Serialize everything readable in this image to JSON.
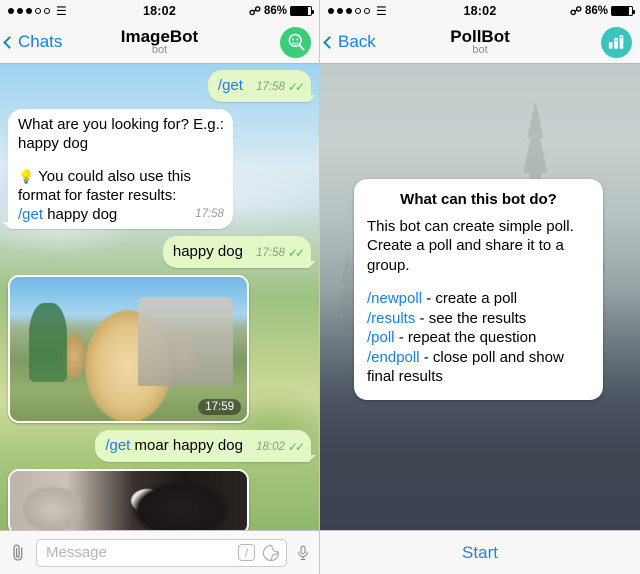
{
  "left": {
    "status": {
      "carrier_dots": 5,
      "carrier_filled": 3,
      "wifi_icon": "wifi-icon",
      "time": "18:02",
      "bluetooth_icon": "bluetooth-icon",
      "battery_text": "86%",
      "battery_level": 86
    },
    "nav": {
      "back_label": "Chats",
      "title": "ImageBot",
      "subtitle": "bot",
      "avatar_icon": "imagebot-avatar-icon",
      "avatar_color": "#3bcd7a"
    },
    "messages": [
      {
        "id": "m1",
        "dir": "out",
        "type": "text",
        "command": "/get",
        "text": "",
        "time": "17:58",
        "ticks": "✓✓"
      },
      {
        "id": "m2",
        "dir": "in",
        "type": "text",
        "line1": "What are you looking for? E.g.:",
        "line2": "happy dog",
        "lamp": "💡",
        "line3": "You could also use this",
        "line4": "format for faster results:",
        "command": "/get",
        "line5": "happy dog",
        "time": "17:58"
      },
      {
        "id": "m3",
        "dir": "out",
        "type": "text",
        "command": "",
        "text": "happy dog",
        "time": "17:58",
        "ticks": "✓✓"
      },
      {
        "id": "m4",
        "dir": "in",
        "type": "photo",
        "alt": "smiling yellow labrador dog photo",
        "time": "17:59"
      },
      {
        "id": "m5",
        "dir": "out",
        "type": "text",
        "command": "/get",
        "text": "moar happy dog",
        "time": "18:02",
        "ticks": "✓✓"
      },
      {
        "id": "m6",
        "dir": "in",
        "type": "photo",
        "alt": "black and white dog photo",
        "time": ""
      }
    ],
    "input": {
      "attach_icon": "paperclip-icon",
      "placeholder": "Message",
      "slash_icon": "/",
      "sticker_icon": "sticker-icon",
      "mic_icon": "microphone-icon"
    }
  },
  "right": {
    "status": {
      "time": "18:02",
      "battery_text": "86%",
      "battery_level": 86
    },
    "nav": {
      "back_label": "Back",
      "title": "PollBot",
      "subtitle": "bot",
      "avatar_icon": "pollbot-avatar-icon",
      "avatar_color": "#3bc3bd"
    },
    "card": {
      "title": "What can this bot do?",
      "desc1": "This bot can create simple poll.",
      "desc2": "Create a poll and share it to a",
      "desc3": "group.",
      "commands": [
        {
          "cmd": "/newpoll",
          "desc": " - create a poll"
        },
        {
          "cmd": "/results",
          "desc": " - see the results"
        },
        {
          "cmd": "/poll",
          "desc": " - repeat the question"
        },
        {
          "cmd": "/endpoll",
          "desc": " - close poll and show"
        }
      ],
      "commands_tail": "final results"
    },
    "start_label": "Start"
  },
  "colors": {
    "accent_blue": "#1a7fe0",
    "out_bubble": "#e3f7c7",
    "in_bubble": "#ffffff",
    "tick_green": "#4cbf4c",
    "start_blue": "#2f7fd6"
  }
}
